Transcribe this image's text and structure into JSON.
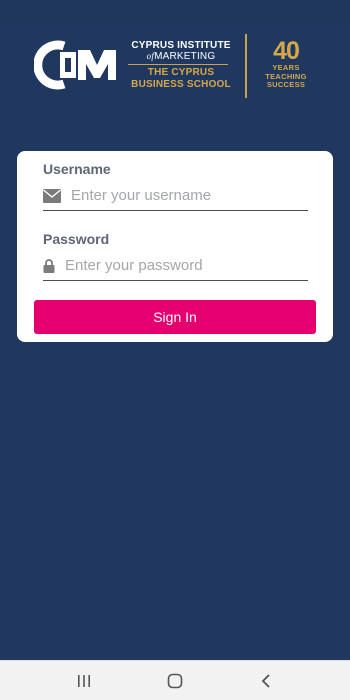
{
  "header": {
    "logo_line1": "CYPRUS INSTITUTE",
    "logo_line2_prefix": "of",
    "logo_line2": "MARKETING",
    "logo_line3": "THE CYPRUS",
    "logo_line4": "BUSINESS SCHOOL",
    "anniversary_number": "40",
    "anniversary_line1": "YEARS",
    "anniversary_line2": "TEACHING",
    "anniversary_line3": "SUCCESS"
  },
  "login": {
    "username_label": "Username",
    "username_placeholder": "Enter your username",
    "username_icon": "envelope-icon",
    "password_label": "Password",
    "password_placeholder": "Enter your password",
    "password_icon": "lock-icon",
    "signin_label": "Sign In"
  },
  "colors": {
    "background": "#203860",
    "accent": "#e6006f",
    "gold": "#d4a84a",
    "card": "#ffffff"
  },
  "navbar": {
    "recents_icon": "recents-icon",
    "home_icon": "home-icon",
    "back_icon": "back-icon"
  }
}
